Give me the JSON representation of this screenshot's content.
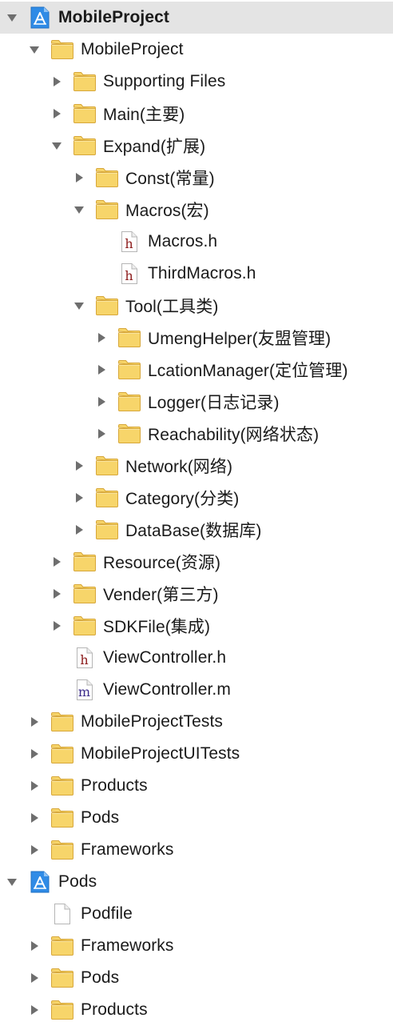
{
  "tree": [
    {
      "label": "MobileProject",
      "depth": 0,
      "icon": "project-icon",
      "disclosure": "open",
      "selected": true
    },
    {
      "label": "MobileProject",
      "depth": 1,
      "icon": "folder-icon",
      "disclosure": "open"
    },
    {
      "label": "Supporting Files",
      "depth": 2,
      "icon": "folder-icon",
      "disclosure": "closed"
    },
    {
      "label": "Main(主要)",
      "depth": 2,
      "icon": "folder-icon",
      "disclosure": "closed"
    },
    {
      "label": "Expand(扩展)",
      "depth": 2,
      "icon": "folder-icon",
      "disclosure": "open"
    },
    {
      "label": "Const(常量)",
      "depth": 3,
      "icon": "folder-icon",
      "disclosure": "closed"
    },
    {
      "label": "Macros(宏)",
      "depth": 3,
      "icon": "folder-icon",
      "disclosure": "open"
    },
    {
      "label": "Macros.h",
      "depth": 4,
      "icon": "header-file-icon",
      "icon_letter": "h",
      "disclosure": "none"
    },
    {
      "label": "ThirdMacros.h",
      "depth": 4,
      "icon": "header-file-icon",
      "icon_letter": "h",
      "disclosure": "none"
    },
    {
      "label": "Tool(工具类)",
      "depth": 3,
      "icon": "folder-icon",
      "disclosure": "open"
    },
    {
      "label": "UmengHelper(友盟管理)",
      "depth": 4,
      "icon": "folder-icon",
      "disclosure": "closed"
    },
    {
      "label": "LcationManager(定位管理)",
      "depth": 4,
      "icon": "folder-icon",
      "disclosure": "closed"
    },
    {
      "label": "Logger(日志记录)",
      "depth": 4,
      "icon": "folder-icon",
      "disclosure": "closed"
    },
    {
      "label": "Reachability(网络状态)",
      "depth": 4,
      "icon": "folder-icon",
      "disclosure": "closed"
    },
    {
      "label": "Network(网络)",
      "depth": 3,
      "icon": "folder-icon",
      "disclosure": "closed"
    },
    {
      "label": "Category(分类)",
      "depth": 3,
      "icon": "folder-icon",
      "disclosure": "closed"
    },
    {
      "label": "DataBase(数据库)",
      "depth": 3,
      "icon": "folder-icon",
      "disclosure": "closed"
    },
    {
      "label": "Resource(资源)",
      "depth": 2,
      "icon": "folder-icon",
      "disclosure": "closed"
    },
    {
      "label": "Vender(第三方)",
      "depth": 2,
      "icon": "folder-icon",
      "disclosure": "closed"
    },
    {
      "label": "SDKFile(集成)",
      "depth": 2,
      "icon": "folder-icon",
      "disclosure": "closed"
    },
    {
      "label": "ViewController.h",
      "depth": 2,
      "icon": "header-file-icon",
      "icon_letter": "h",
      "disclosure": "none"
    },
    {
      "label": "ViewController.m",
      "depth": 2,
      "icon": "source-file-icon",
      "icon_letter": "m",
      "disclosure": "none"
    },
    {
      "label": "MobileProjectTests",
      "depth": 1,
      "icon": "folder-icon",
      "disclosure": "closed"
    },
    {
      "label": "MobileProjectUITests",
      "depth": 1,
      "icon": "folder-icon",
      "disclosure": "closed"
    },
    {
      "label": "Products",
      "depth": 1,
      "icon": "folder-icon",
      "disclosure": "closed"
    },
    {
      "label": "Pods",
      "depth": 1,
      "icon": "folder-icon",
      "disclosure": "closed"
    },
    {
      "label": "Frameworks",
      "depth": 1,
      "icon": "folder-icon",
      "disclosure": "closed"
    },
    {
      "label": "Pods",
      "depth": 0,
      "icon": "project-icon",
      "disclosure": "open"
    },
    {
      "label": "Podfile",
      "depth": 1,
      "icon": "document-icon",
      "disclosure": "none"
    },
    {
      "label": "Frameworks",
      "depth": 1,
      "icon": "folder-icon",
      "disclosure": "closed"
    },
    {
      "label": "Pods",
      "depth": 1,
      "icon": "folder-icon",
      "disclosure": "closed"
    },
    {
      "label": "Products",
      "depth": 1,
      "icon": "folder-icon",
      "disclosure": "closed"
    }
  ],
  "colors": {
    "selection": "#e4e4e4",
    "folder_body": "#f7d56a",
    "folder_border": "#d7a73a",
    "disclosure": "#6e6e6e",
    "project_icon": "#2f8be6",
    "header_letter": "#8b1a1a",
    "source_letter": "#3a2a8a"
  }
}
